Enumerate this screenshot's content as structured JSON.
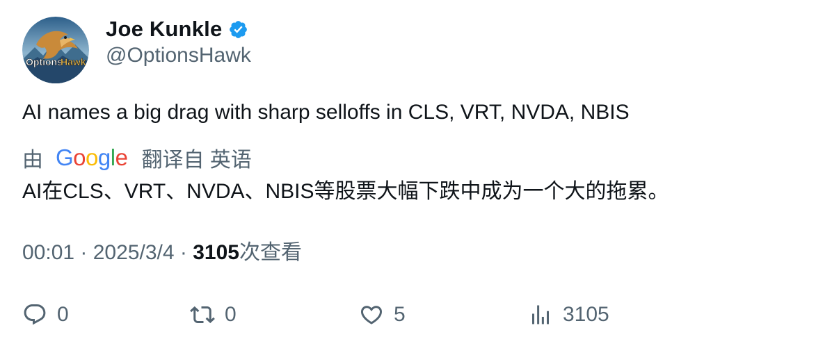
{
  "author": {
    "display_name": "Joe Kunkle",
    "handle": "@OptionsHawk",
    "verified_icon": "verified-badge-icon",
    "verified_color": "#1d9bf0",
    "avatar_text": "OptionsHawk"
  },
  "tweet": {
    "text": "AI names a big drag with sharp selloffs in CLS, VRT, NVDA, NBIS"
  },
  "translation": {
    "by_label": "由",
    "provider": "Google",
    "translated_from_label": "翻译自 英语",
    "translated_text": "AI在CLS、VRT、NVDA、NBIS等股票大幅下跌中成为一个大的拖累。"
  },
  "meta": {
    "time": "00:01",
    "separator": " · ",
    "date": "2025/3/4",
    "views_count": "3105",
    "views_label": "次查看"
  },
  "actions": {
    "reply": {
      "icon": "reply-icon",
      "count": "0"
    },
    "retweet": {
      "icon": "retweet-icon",
      "count": "0"
    },
    "like": {
      "icon": "heart-icon",
      "count": "5"
    },
    "views": {
      "icon": "analytics-icon",
      "count": "3105"
    }
  },
  "colors": {
    "text_primary": "#0f1419",
    "text_secondary": "#536471",
    "google_blue": "#4285f4",
    "google_red": "#ea4335",
    "google_yellow": "#fbbc05",
    "google_green": "#34a853"
  }
}
